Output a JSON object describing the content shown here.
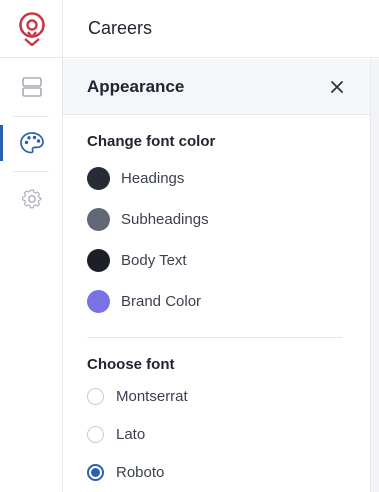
{
  "header": {
    "title": "Careers"
  },
  "sidebar": {
    "items": [
      {
        "name": "layout",
        "icon": "layout-icon"
      },
      {
        "name": "appearance",
        "icon": "palette-icon",
        "active": true
      },
      {
        "name": "settings",
        "icon": "gear-icon"
      }
    ]
  },
  "panel": {
    "title": "Appearance",
    "close_icon": "close-icon",
    "font_color": {
      "title": "Change font color",
      "items": [
        {
          "label": "Headings",
          "color": "#272b36"
        },
        {
          "label": "Subheadings",
          "color": "#626776"
        },
        {
          "label": "Body Text",
          "color": "#1c1f28"
        },
        {
          "label": "Brand Color",
          "color": "#7a72e4"
        }
      ]
    },
    "font": {
      "title": "Choose font",
      "options": [
        {
          "label": "Montserrat",
          "selected": false
        },
        {
          "label": "Lato",
          "selected": false
        },
        {
          "label": "Roboto",
          "selected": true
        }
      ]
    }
  },
  "colors": {
    "accent": "#2b5fb3",
    "logo": "#c8384a"
  }
}
